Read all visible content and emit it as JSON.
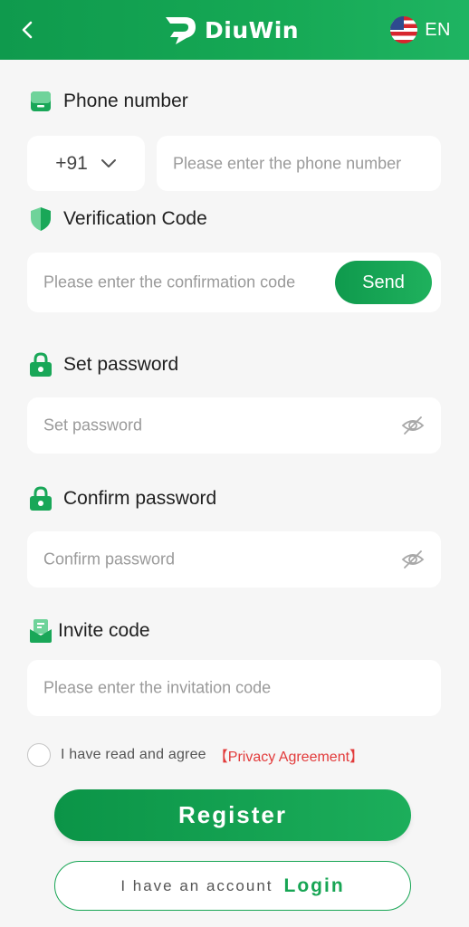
{
  "header": {
    "brand": "DiuWin",
    "language": "EN",
    "icons": {
      "back": "chevron-left-icon",
      "logo": "diuwin-logo-icon",
      "flag": "us-flag-icon"
    }
  },
  "form": {
    "phone": {
      "label": "Phone number",
      "country_code": "+91",
      "placeholder": "Please enter the phone number",
      "icon": "phone-icon"
    },
    "verification": {
      "label": "Verification Code",
      "placeholder": "Please enter the confirmation code",
      "send_label": "Send",
      "icon": "shield-icon"
    },
    "password": {
      "label": "Set password",
      "placeholder": "Set password",
      "icon": "lock-icon"
    },
    "confirm": {
      "label": "Confirm password",
      "placeholder": "Confirm password",
      "icon": "lock-icon"
    },
    "invite": {
      "label": "Invite code",
      "placeholder": "Please enter the invitation code",
      "icon": "invite-icon"
    }
  },
  "agreement": {
    "text": "I have read and agree",
    "link": "【Privacy Agreement】"
  },
  "actions": {
    "register_label": "Register",
    "account_text": "I have an account",
    "login_label": "Login"
  },
  "colors": {
    "brand_green": "#17a554",
    "header_green": "#0f9a4d",
    "link_red": "#e23b3b",
    "background": "#f6f6f6"
  }
}
